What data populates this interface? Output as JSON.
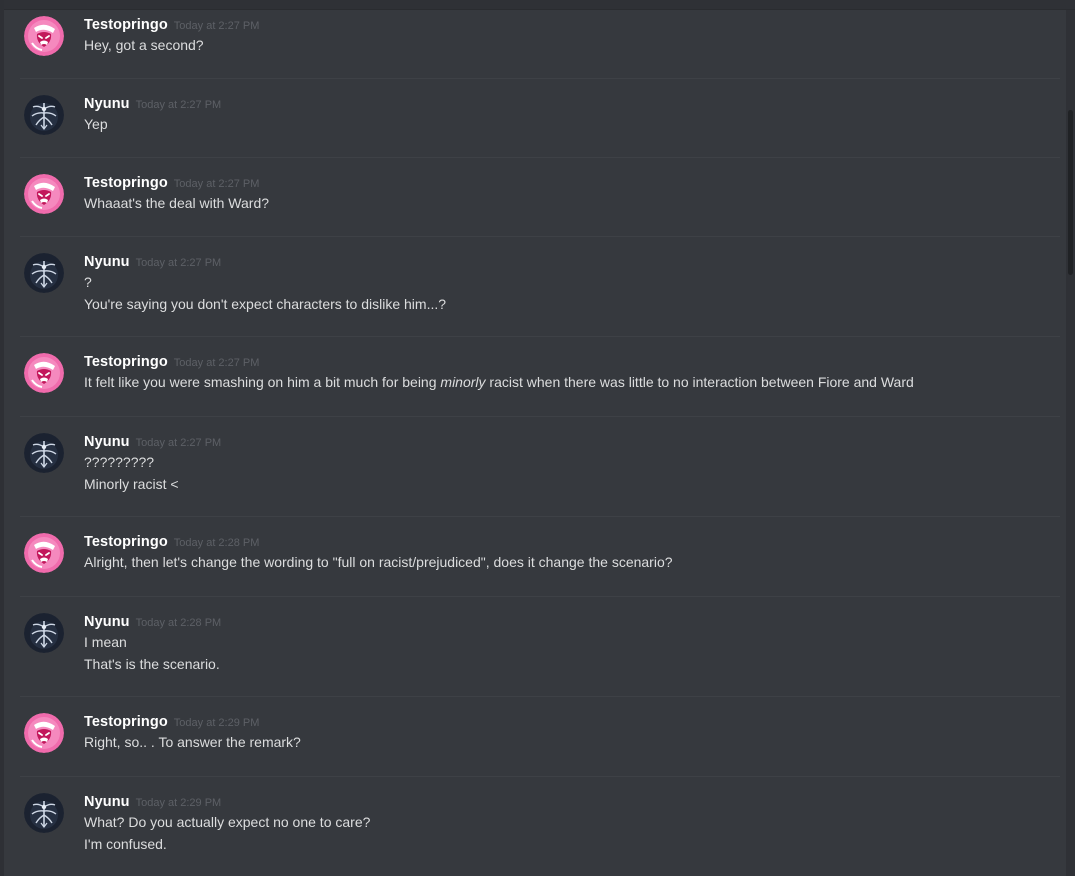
{
  "colors": {
    "background": "#36393e",
    "username": "#ffffff",
    "timestamp": "#5d6066",
    "text": "#dcddde",
    "divider": "#3e4146",
    "avatar_testopringo": "#f06bac",
    "avatar_nyunu": "#1b2230"
  },
  "messages": [
    {
      "avatar": "testopringo-avatar",
      "username": "Testopringo",
      "timestamp": "Today at 2:27 PM",
      "lines": [
        "Hey, got a second?"
      ]
    },
    {
      "avatar": "nyunu-avatar",
      "username": "Nyunu",
      "timestamp": "Today at 2:27 PM",
      "lines": [
        "Yep"
      ]
    },
    {
      "avatar": "testopringo-avatar",
      "username": "Testopringo",
      "timestamp": "Today at 2:27 PM",
      "lines": [
        "Whaaat's the deal with Ward?"
      ]
    },
    {
      "avatar": "nyunu-avatar",
      "username": "Nyunu",
      "timestamp": "Today at 2:27 PM",
      "lines": [
        "?",
        "You're saying you don't expect characters to dislike him...?"
      ]
    },
    {
      "avatar": "testopringo-avatar",
      "username": "Testopringo",
      "timestamp": "Today at 2:27 PM",
      "lines": [
        {
          "before": "It felt like you were smashing on him a bit much for being ",
          "emphasis": "minorly",
          "after": " racist when there was little to no interaction between Fiore and Ward"
        }
      ]
    },
    {
      "avatar": "nyunu-avatar",
      "username": "Nyunu",
      "timestamp": "Today at 2:27 PM",
      "lines": [
        "?????????",
        "Minorly racist <"
      ]
    },
    {
      "avatar": "testopringo-avatar",
      "username": "Testopringo",
      "timestamp": "Today at 2:28 PM",
      "lines": [
        "Alright, then let's change the wording to \"full on racist/prejudiced\", does it change the scenario?"
      ]
    },
    {
      "avatar": "nyunu-avatar",
      "username": "Nyunu",
      "timestamp": "Today at 2:28 PM",
      "lines": [
        "I mean",
        "That's is the scenario."
      ]
    },
    {
      "avatar": "testopringo-avatar",
      "username": "Testopringo",
      "timestamp": "Today at 2:29 PM",
      "lines": [
        "Right, so.. . To answer the remark?"
      ]
    },
    {
      "avatar": "nyunu-avatar",
      "username": "Nyunu",
      "timestamp": "Today at 2:29 PM",
      "lines": [
        "What? Do you actually expect no one to care?",
        "I'm confused."
      ]
    }
  ]
}
